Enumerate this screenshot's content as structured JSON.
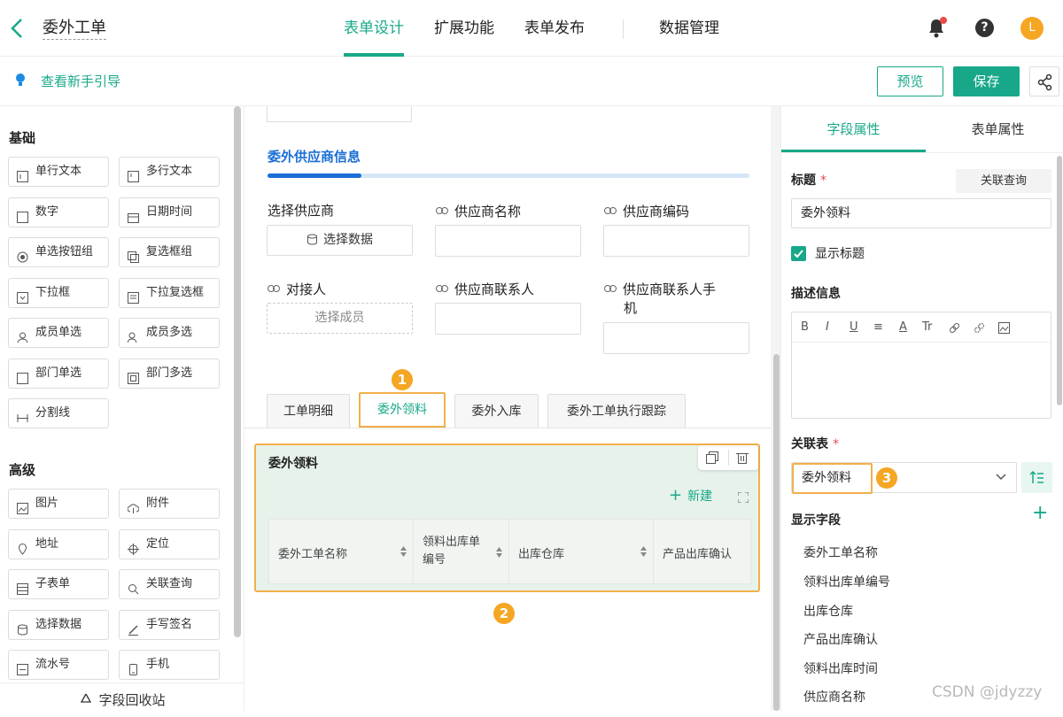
{
  "header": {
    "app_title": "委外工单",
    "nav_tabs": [
      "表单设计",
      "扩展功能",
      "表单发布",
      "数据管理"
    ],
    "avatar_letter": "L"
  },
  "subbar": {
    "guide_text": "查看新手引导",
    "preview_label": "预览",
    "save_label": "保存"
  },
  "left_panel": {
    "basic_title": "基础",
    "basic_widgets": [
      "单行文本",
      "多行文本",
      "数字",
      "日期时间",
      "单选按钮组",
      "复选框组",
      "下拉框",
      "下拉复选框",
      "成员单选",
      "成员多选",
      "部门单选",
      "部门多选",
      "分割线"
    ],
    "advanced_title": "高级",
    "advanced_widgets": [
      "图片",
      "附件",
      "地址",
      "定位",
      "子表单",
      "关联查询",
      "选择数据",
      "手写签名",
      "流水号",
      "手机"
    ],
    "recycle_label": "字段回收站"
  },
  "canvas": {
    "group_title": "委外供应商信息",
    "fields": {
      "select_supplier": "选择供应商",
      "select_data_btn": "选择数据",
      "supplier_name": "供应商名称",
      "supplier_code": "供应商编码",
      "contact": "对接人",
      "select_member": "选择成员",
      "supplier_contact": "供应商联系人",
      "supplier_contact_phone_1": "供应商联系人手",
      "supplier_contact_phone_2": "机"
    },
    "tabs": [
      "工单明细",
      "委外领料",
      "委外入库",
      "委外工单执行跟踪"
    ],
    "subform": {
      "title": "委外领料",
      "new_label": "新建",
      "columns": [
        "委外工单名称",
        "领料出库单编号",
        "出库仓库",
        "产品出库确认"
      ]
    },
    "badges": [
      "1",
      "2",
      "3"
    ]
  },
  "right_panel": {
    "tabs": [
      "字段属性",
      "表单属性"
    ],
    "title_label": "标题",
    "rel_query_btn": "关联查询",
    "title_value": "委外领料",
    "show_title_label": "显示标题",
    "desc_label": "描述信息",
    "editor_tools": [
      "B",
      "I",
      "U",
      "≡",
      "A",
      "Tr"
    ],
    "rel_table_label": "关联表",
    "rel_table_value": "委外领料",
    "display_fields_label": "显示字段",
    "display_fields": [
      "委外工单名称",
      "领料出库单编号",
      "出库仓库",
      "产品出库确认",
      "领料出库时间",
      "供应商名称"
    ]
  },
  "watermark": "CSDN @jdyzzy",
  "colors": {
    "accent": "#18a889",
    "highlight": "#f2b04c",
    "badge": "#f5a623",
    "group_blue": "#1a6fd6"
  }
}
